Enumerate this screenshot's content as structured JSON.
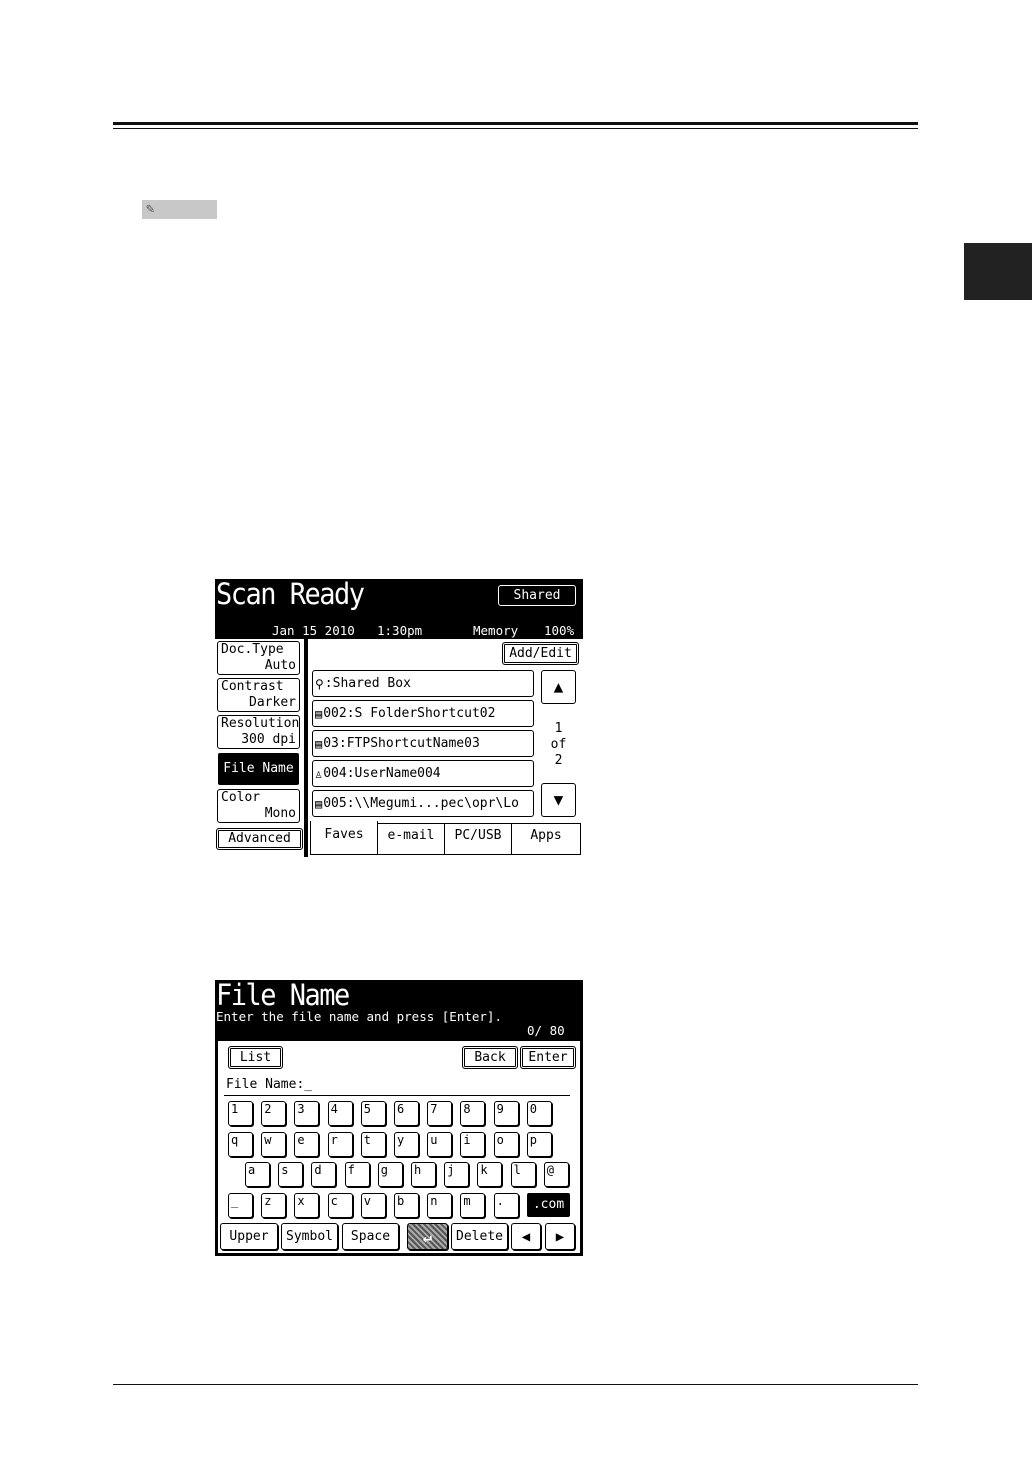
{
  "screen1": {
    "title": "Scan Ready",
    "shared_label": "Shared",
    "date": "Jan 15 2010",
    "time": "1:30pm",
    "memory_label": "Memory",
    "memory_value": "100%",
    "settings": [
      {
        "label": "Doc.Type",
        "value": "Auto"
      },
      {
        "label": "Contrast",
        "value": "Darker"
      },
      {
        "label": "Resolution",
        "value": "300 dpi"
      },
      {
        "label": "File Name",
        "value": ""
      },
      {
        "label": "Color",
        "value": "Mono"
      }
    ],
    "advanced_label": "Advanced",
    "add_edit_label": "Add/Edit",
    "entries": [
      {
        "icon": "shared-box-icon",
        "glyph": "⚲",
        "text": ":Shared Box"
      },
      {
        "icon": "folder-shortcut-icon",
        "glyph": "▤",
        "text": "002:S FolderShortcut02"
      },
      {
        "icon": "ftp-shortcut-icon",
        "glyph": "▤",
        "text": "03:FTPShortcutName03"
      },
      {
        "icon": "user-icon",
        "glyph": "♙",
        "text": "004:UserName004"
      },
      {
        "icon": "folder-shortcut-icon",
        "glyph": "▤",
        "text": "005:\\\\Megumi...pec\\opr\\Lo"
      }
    ],
    "page_current": "1",
    "page_of": "of",
    "page_total": "2",
    "tabs": [
      "Faves",
      "e-mail",
      "PC/USB",
      "Apps"
    ]
  },
  "screen2": {
    "title": "File Name",
    "instruction": "Enter the file name and press [Enter].",
    "counter": "0/ 80",
    "list_label": "List",
    "back_label": "Back",
    "enter_label": "Enter",
    "field_label": "File Name:_",
    "rows": [
      [
        "1",
        "2",
        "3",
        "4",
        "5",
        "6",
        "7",
        "8",
        "9",
        "0"
      ],
      [
        "q",
        "w",
        "e",
        "r",
        "t",
        "y",
        "u",
        "i",
        "o",
        "p"
      ],
      [
        "a",
        "s",
        "d",
        "f",
        "g",
        "h",
        "j",
        "k",
        "l",
        "@"
      ],
      [
        "_",
        "z",
        "x",
        "c",
        "v",
        "b",
        "n",
        "m",
        "."
      ]
    ],
    "dotcom_label": ".com",
    "bottom": {
      "upper": "Upper",
      "symbol": "Symbol",
      "space": "Space",
      "delete": "Delete"
    }
  }
}
